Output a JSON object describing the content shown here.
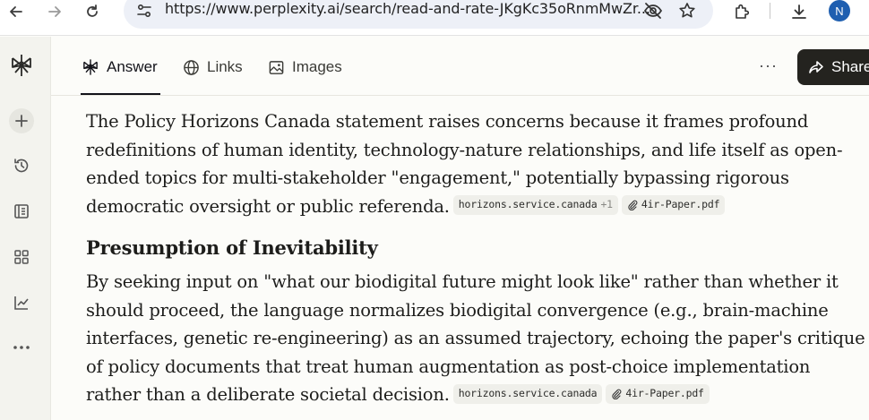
{
  "browser": {
    "url": "https://www.perplexity.ai/search/read-and-rate-JKgKc35oRnmMwZr...",
    "avatar_letter": "N"
  },
  "tabs": [
    {
      "label": "Answer",
      "icon": "perplexity-logo-icon",
      "active": true
    },
    {
      "label": "Links",
      "icon": "globe-icon",
      "active": false
    },
    {
      "label": "Images",
      "icon": "image-icon",
      "active": false
    }
  ],
  "share_label": "Share",
  "more_label": "···",
  "sidebar": {
    "items": [
      "perplexity-logo-icon",
      "new-thread-icon",
      "history-icon",
      "library-icon",
      "spaces-icon",
      "finance-icon",
      "more-icon"
    ]
  },
  "content": {
    "para1": "The Policy Horizons Canada statement raises concerns because it frames profound redefinitions of human identity, technology-nature relationships, and life itself as open-ended topics for multi-stakeholder \"engagement,\" potentially bypassing rigorous democratic oversight or public referenda.",
    "para1_citations": [
      {
        "label": "horizons.service.canada",
        "extra": "+1"
      },
      {
        "label": "4ir-Paper.pdf",
        "extra": ""
      }
    ],
    "heading": "Presumption of Inevitability",
    "para2": "By seeking input on \"what our biodigital future might look like\" rather than whether it should proceed, the language normalizes biodigital convergence (e.g., brain-machine interfaces, genetic re-engineering) as an assumed trajectory, echoing the paper's critique of policy documents that treat human augmentation as post-choice implementation rather than a deliberate societal decision.",
    "para2_citations": [
      {
        "label": "horizons.service.canada",
        "extra": ""
      },
      {
        "label": "4ir-Paper.pdf",
        "extra": ""
      }
    ]
  },
  "colors": {
    "accent_dark": "#24231f",
    "background": "#fcfcf9",
    "sidebar": "#f3f3ee",
    "avatar": "#1f5fb0"
  }
}
